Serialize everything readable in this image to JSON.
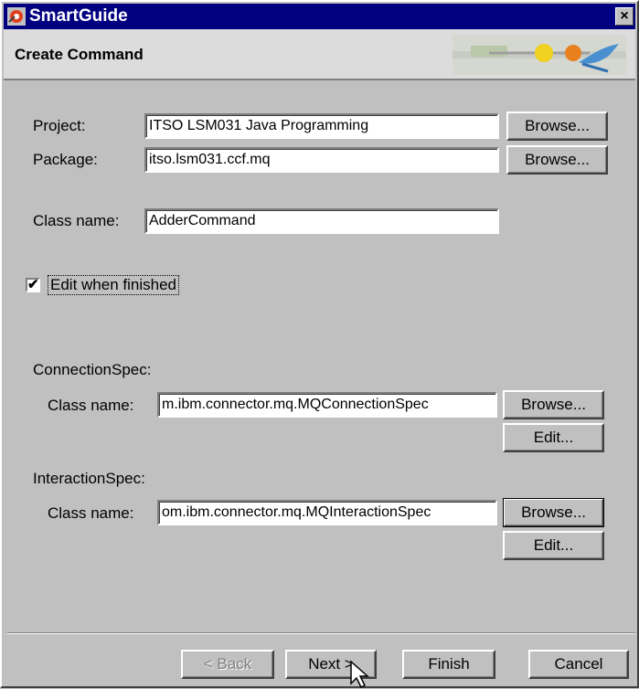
{
  "window": {
    "title": "SmartGuide",
    "close_glyph": "×"
  },
  "banner": {
    "title": "Create Command"
  },
  "project": {
    "label": "Project:",
    "value": "ITSO LSM031 Java Programming",
    "browse": "Browse..."
  },
  "package": {
    "label": "Package:",
    "value": "itso.lsm031.ccf.mq",
    "browse": "Browse..."
  },
  "class_name": {
    "label": "Class name:",
    "value": "AdderCommand"
  },
  "edit_when_finished": {
    "label": "Edit when finished",
    "checked": true
  },
  "connection_spec": {
    "section": "ConnectionSpec:",
    "label": "Class name:",
    "value": "m.ibm.connector.mq.MQConnectionSpec",
    "browse": "Browse...",
    "edit": "Edit..."
  },
  "interaction_spec": {
    "section": "InteractionSpec:",
    "label": "Class name:",
    "value": "om.ibm.connector.mq.MQInteractionSpec",
    "browse": "Browse...",
    "edit": "Edit..."
  },
  "buttons": {
    "back": "< Back",
    "next": "Next >",
    "finish": "Finish",
    "cancel": "Cancel"
  },
  "icons": {
    "app": "smartguide-icon",
    "banner": "smartguide-logo",
    "cursor": "mouse-pointer"
  },
  "colors": {
    "titlebar": "#000080",
    "face": "#c0c0c0",
    "banner": "#dcdcdc"
  }
}
